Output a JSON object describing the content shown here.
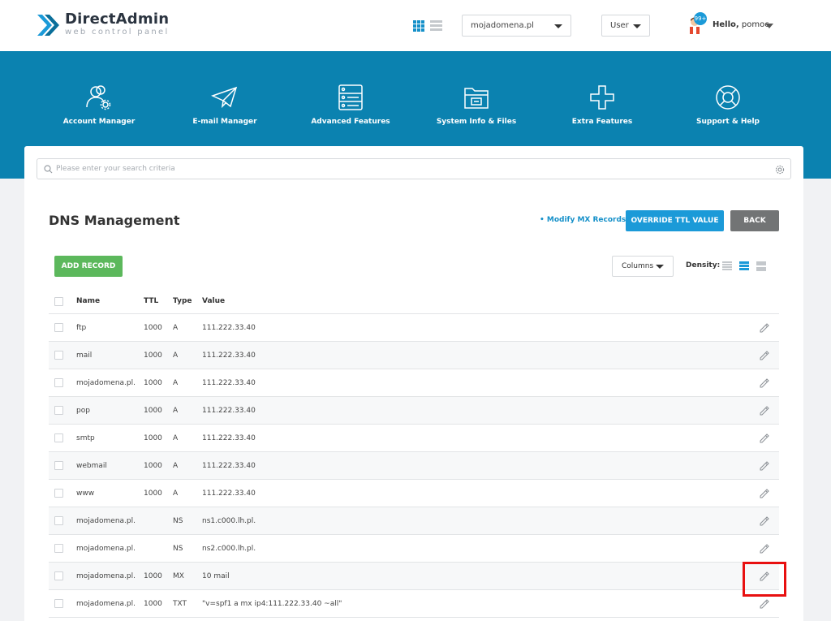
{
  "header": {
    "brand_name": "DirectAdmin",
    "brand_tagline": "web control panel",
    "domain_select": "mojadomena.pl",
    "role_select": "User",
    "notification_count": "99+",
    "greeting": "Hello,",
    "username": "pomoc"
  },
  "nav": [
    {
      "label": "Account Manager",
      "icon": "account-manager-icon"
    },
    {
      "label": "E-mail Manager",
      "icon": "email-manager-icon"
    },
    {
      "label": "Advanced Features",
      "icon": "advanced-features-icon"
    },
    {
      "label": "System Info & Files",
      "icon": "system-info-icon"
    },
    {
      "label": "Extra Features",
      "icon": "extra-features-icon"
    },
    {
      "label": "Support & Help",
      "icon": "support-help-icon"
    }
  ],
  "search": {
    "placeholder": "Please enter your search criteria"
  },
  "page": {
    "title": "DNS Management",
    "modify_mx_link": "• Modify MX Records",
    "override_ttl_button": "OVERRIDE TTL VALUE",
    "back_button": "BACK",
    "add_record_button": "ADD RECORD",
    "columns_button": "Columns",
    "density_label": "Density:"
  },
  "table": {
    "headers": {
      "name": "Name",
      "ttl": "TTL",
      "type": "Type",
      "value": "Value"
    },
    "rows": [
      {
        "name": "ftp",
        "ttl": "1000",
        "type": "A",
        "value": "111.222.33.40"
      },
      {
        "name": "mail",
        "ttl": "1000",
        "type": "A",
        "value": "111.222.33.40"
      },
      {
        "name": "mojadomena.pl.",
        "ttl": "1000",
        "type": "A",
        "value": "111.222.33.40"
      },
      {
        "name": "pop",
        "ttl": "1000",
        "type": "A",
        "value": "111.222.33.40"
      },
      {
        "name": "smtp",
        "ttl": "1000",
        "type": "A",
        "value": "111.222.33.40"
      },
      {
        "name": "webmail",
        "ttl": "1000",
        "type": "A",
        "value": "111.222.33.40"
      },
      {
        "name": "www",
        "ttl": "1000",
        "type": "A",
        "value": "111.222.33.40"
      },
      {
        "name": "mojadomena.pl.",
        "ttl": "",
        "type": "NS",
        "value": "ns1.c000.lh.pl."
      },
      {
        "name": "mojadomena.pl.",
        "ttl": "",
        "type": "NS",
        "value": "ns2.c000.lh.pl."
      },
      {
        "name": "mojadomena.pl.",
        "ttl": "1000",
        "type": "MX",
        "value": "10 mail"
      },
      {
        "name": "mojadomena.pl.",
        "ttl": "1000",
        "type": "TXT",
        "value": "\"v=spf1 a mx ip4:111.222.33.40 ~all\""
      }
    ]
  },
  "colors": {
    "brand_blue": "#0b82b0",
    "accent_blue": "#1b9ad8",
    "add_green": "#5cb85c",
    "back_gray": "#727475",
    "highlight_red": "#e81010"
  }
}
